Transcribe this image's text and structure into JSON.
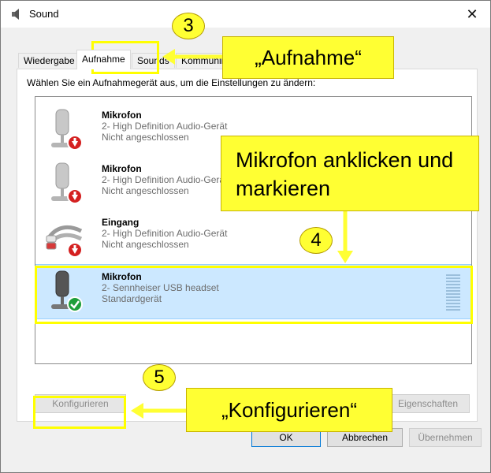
{
  "window": {
    "title": "Sound",
    "close_glyph": "✕"
  },
  "tabs": [
    {
      "label": "Wiedergabe"
    },
    {
      "label": "Aufnahme"
    },
    {
      "label": "Sounds"
    },
    {
      "label": "Kommunikation"
    }
  ],
  "instruction": "Wählen Sie ein Aufnahmegerät aus, um die Einstellungen zu ändern:",
  "devices": [
    {
      "name": "Mikrofon",
      "description": "2- High Definition Audio-Gerät",
      "status": "Nicht angeschlossen",
      "icon": "microphone-icon",
      "badge": "disconnected-arrow-icon"
    },
    {
      "name": "Mikrofon",
      "description": "2- High Definition Audio-Gerät",
      "status": "Nicht angeschlossen",
      "icon": "microphone-icon",
      "badge": "disconnected-arrow-icon"
    },
    {
      "name": "Eingang",
      "description": "2- High Definition Audio-Gerät",
      "status": "Nicht angeschlossen",
      "icon": "audio-cable-icon",
      "badge": "disconnected-arrow-icon"
    },
    {
      "name": "Mikrofon",
      "description": "2- Sennheiser USB headset",
      "status": "Standardgerät",
      "icon": "microphone-icon",
      "badge": "default-check-icon",
      "selected": true
    }
  ],
  "buttons": {
    "configure": "Konfigurieren",
    "properties": "Eigenschaften",
    "ok": "OK",
    "cancel": "Abbrechen",
    "apply": "Übernehmen"
  },
  "annotations": {
    "step3_number": "3",
    "step3_label": "„Aufnahme“",
    "step4_number": "4",
    "step4_label": "Mikrofon anklicken und markieren",
    "step5_number": "5",
    "step5_label": "„Konfigurieren“"
  },
  "colors": {
    "highlight": "#ffff33",
    "selection": "#cce8ff"
  }
}
